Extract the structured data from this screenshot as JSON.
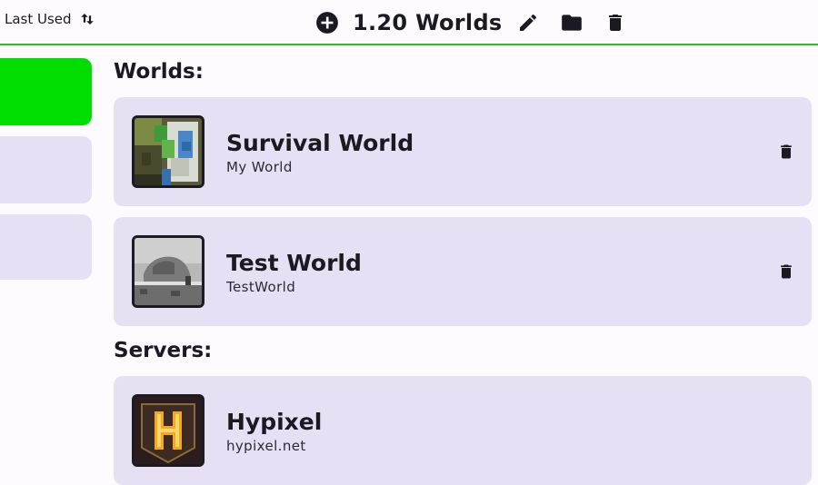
{
  "toolbar": {
    "sort_label": "Last Used",
    "title": "1.20 Worlds",
    "accent_color": "#22c322"
  },
  "sidebar": {
    "active_color": "#00dd00",
    "tabs": [
      {
        "label": "",
        "active": true
      },
      {
        "label": "",
        "active": false
      },
      {
        "label": "",
        "active": false
      }
    ]
  },
  "main": {
    "worlds_heading": "Worlds:",
    "worlds": [
      {
        "name": "Survival World",
        "folder": "My World"
      },
      {
        "name": "Test World",
        "folder": "TestWorld"
      }
    ],
    "servers_heading": "Servers:",
    "servers": [
      {
        "name": "Hypixel",
        "address": "hypixel.net"
      }
    ]
  },
  "icons": [
    "sort-icon",
    "add-icon",
    "edit-icon",
    "folder-icon",
    "trash-icon"
  ]
}
